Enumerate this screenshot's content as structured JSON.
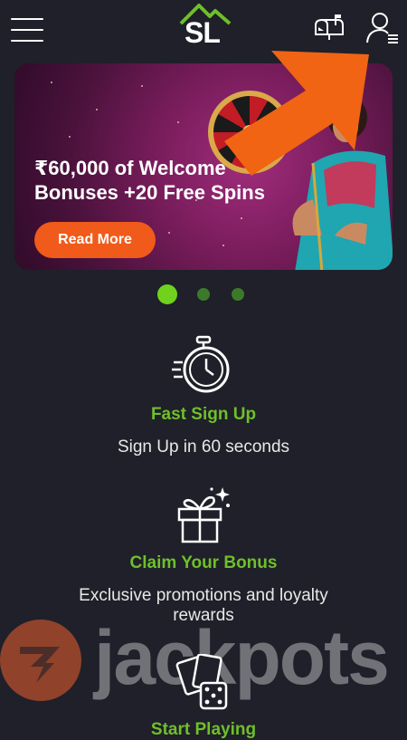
{
  "header": {
    "logo_text": "SL",
    "icons": [
      "hamburger-menu-icon",
      "mailbox-icon",
      "user-menu-icon"
    ]
  },
  "banner": {
    "title_line1": "₹60,000 of Welcome",
    "title_line2": "Bonuses +20 Free Spins",
    "cta_label": "Read More"
  },
  "carousel": {
    "active_index": 0,
    "count": 3,
    "active_color": "#6fd21c",
    "inactive_color": "#3c7a2a"
  },
  "features": [
    {
      "icon": "stopwatch-icon",
      "title": "Fast Sign Up",
      "desc": "Sign Up in 60 seconds"
    },
    {
      "icon": "gift-box-icon",
      "title": "Claim Your Bonus",
      "desc_line1": "Exclusive promotions and loyalty",
      "desc_line2": "rewards"
    },
    {
      "icon": "cards-dice-icon",
      "title": "Start Playing"
    }
  ],
  "watermark": {
    "text": "jackpots"
  },
  "colors": {
    "background": "#1f2029",
    "accent_green": "#6fbf2a",
    "cta_orange": "#f05a1a",
    "annotation_arrow": "#f06414"
  }
}
